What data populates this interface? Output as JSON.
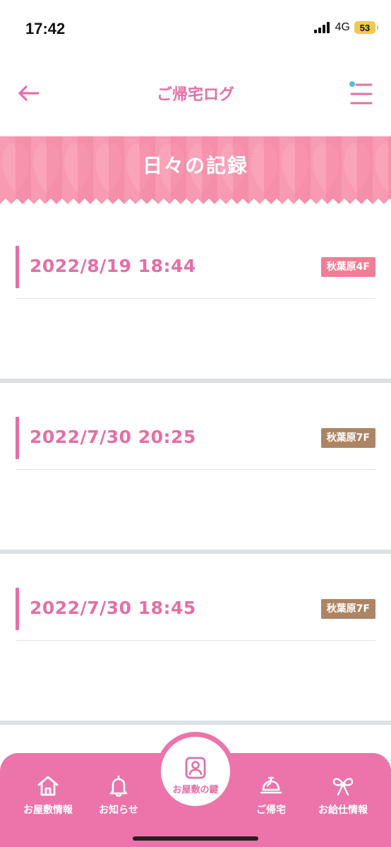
{
  "status_bar": {
    "time": "17:42",
    "network": "4G",
    "battery": "53"
  },
  "nav": {
    "title": "ご帰宅ログ",
    "back_icon": "arrow-left-icon",
    "menu_icon": "menu-icon"
  },
  "banner": {
    "title": "日々の記録"
  },
  "records": [
    {
      "datetime": "2022/8/19 18:44",
      "location": "秋葉原4F",
      "tag_color": "#f07e96"
    },
    {
      "datetime": "2022/7/30 20:25",
      "location": "秋葉原7F",
      "tag_color": "#ad8464"
    },
    {
      "datetime": "2022/7/30 18:45",
      "location": "秋葉原7F",
      "tag_color": "#ad8464"
    }
  ],
  "tabbar": {
    "items": [
      {
        "label": "お屋敷情報",
        "icon": "house-icon"
      },
      {
        "label": "お知らせ",
        "icon": "bell-icon"
      },
      {
        "label": "お屋敷の鍵",
        "icon": "key-card-icon"
      },
      {
        "label": "ご帰宅",
        "icon": "service-bell-icon"
      },
      {
        "label": "お給仕情報",
        "icon": "bow-icon"
      }
    ]
  },
  "colors": {
    "accent": "#e56fa6",
    "tabbar": "#ec74aa",
    "banner": "#f59ab1"
  }
}
